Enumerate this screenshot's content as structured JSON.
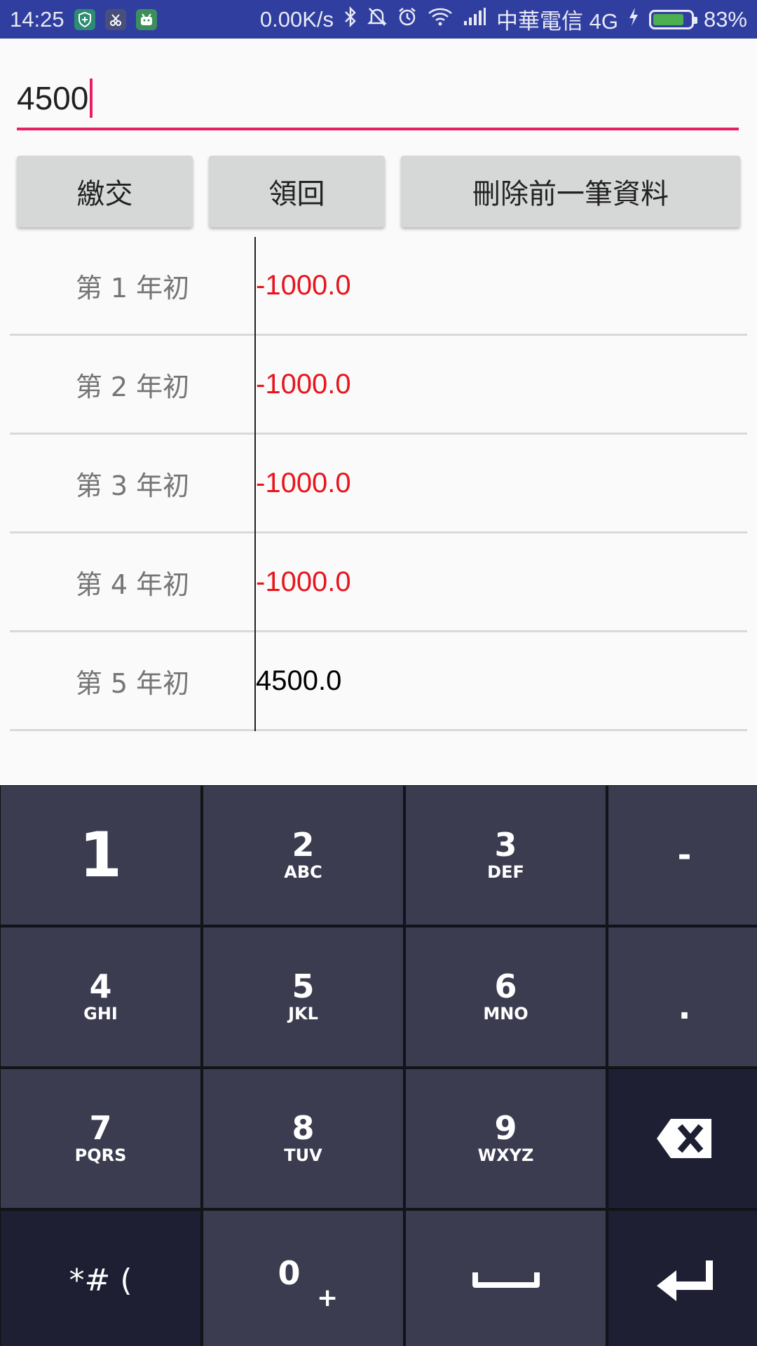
{
  "status_bar": {
    "time": "14:25",
    "net_speed": "0.00K/s",
    "carrier": "中華電信 4G",
    "battery_percent": "83%",
    "battery_level": 0.83,
    "icons": [
      "shield-app-icon",
      "scissors-app-icon",
      "android-app-icon",
      "bluetooth-icon",
      "mute-icon",
      "alarm-icon",
      "wifi-icon",
      "signal-icon",
      "charging-icon",
      "battery-icon"
    ]
  },
  "input": {
    "value": "4500"
  },
  "buttons": {
    "pay": "繳交",
    "receive": "領回",
    "delete": "刪除前一筆資料"
  },
  "rows": [
    {
      "label": "第 1 年初",
      "value": "-1000.0",
      "color": "#e8141d"
    },
    {
      "label": "第 2 年初",
      "value": "-1000.0",
      "color": "#e8141d"
    },
    {
      "label": "第 3 年初",
      "value": "-1000.0",
      "color": "#e8141d"
    },
    {
      "label": "第 4 年初",
      "value": "-1000.0",
      "color": "#e8141d"
    },
    {
      "label": "第 5 年初",
      "value": "4500.0",
      "color": "#000000"
    }
  ],
  "keyboard": {
    "keys": [
      {
        "num": "1",
        "letters": ""
      },
      {
        "num": "2",
        "letters": "ABC"
      },
      {
        "num": "3",
        "letters": "DEF"
      },
      {
        "num": "-",
        "letters": ""
      },
      {
        "num": "4",
        "letters": "GHI"
      },
      {
        "num": "5",
        "letters": "JKL"
      },
      {
        "num": "6",
        "letters": "MNO"
      },
      {
        "num": ".",
        "letters": ""
      },
      {
        "num": "7",
        "letters": "PQRS"
      },
      {
        "num": "8",
        "letters": "TUV"
      },
      {
        "num": "9",
        "letters": "WXYZ"
      },
      {
        "num": "0",
        "letters": "+"
      }
    ],
    "symbols_label": "*# (",
    "icons": [
      "backspace-icon",
      "space-icon",
      "enter-icon"
    ]
  },
  "colors": {
    "status_bar": "#303f9f",
    "accent": "#e91e63",
    "negative": "#e8141d",
    "key_bg": "#3b3c50",
    "key_dark_bg": "#1e1f33"
  }
}
